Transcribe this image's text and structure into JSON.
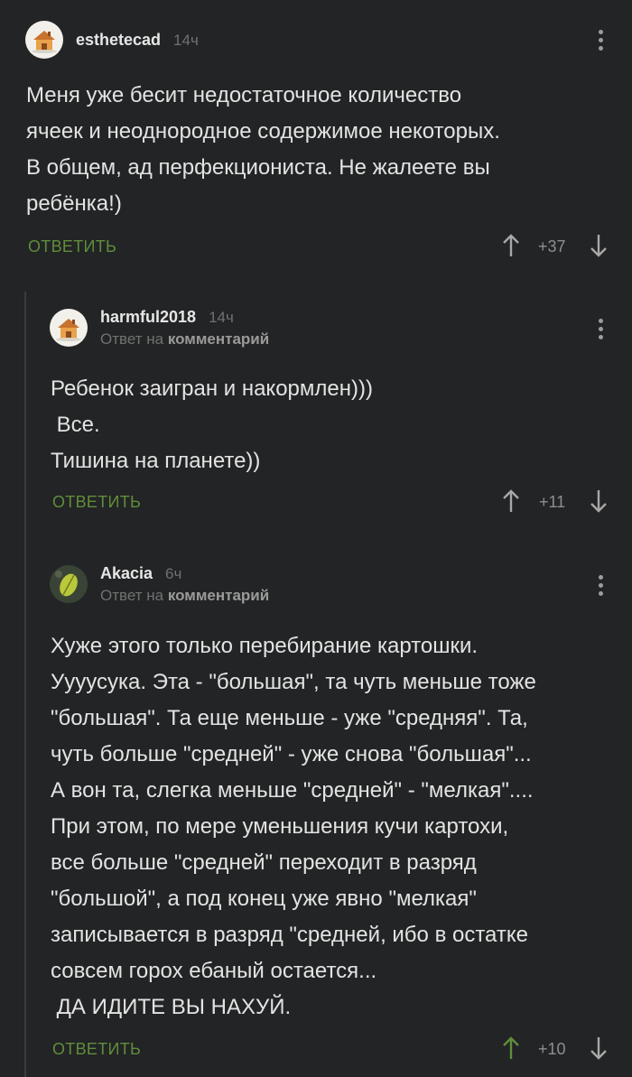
{
  "comments": [
    {
      "username": "esthetecad",
      "time": "14ч",
      "text": "Меня уже бесит недостаточное количество\nячеек и неоднородное содержимое некоторых.\nВ общем, ад перфекциониста. Не жалеете вы\nребёнка!)",
      "reply_label": "ОТВЕТИТЬ",
      "score": "+37",
      "avatar_icon": "house-avatar",
      "upvote_color": "#a8a8a8"
    },
    {
      "username": "harmful2018",
      "time": "14ч",
      "reply_to_prefix": "Ответ на",
      "reply_to_target": "комментарий",
      "text": "Ребенок заигран и накормлен)))\n Все.\nТишина на планете))",
      "reply_label": "ОТВЕТИТЬ",
      "score": "+11",
      "avatar_icon": "house-avatar",
      "upvote_color": "#a8a8a8"
    },
    {
      "username": "Akacia",
      "time": "6ч",
      "reply_to_prefix": "Ответ на",
      "reply_to_target": "комментарий",
      "text": "Хуже этого только перебирание картошки.\nУууусука. Эта - \"большая\", та чуть меньше тоже\n\"большая\". Та еще меньше - уже \"средняя\". Та,\nчуть больше \"средней\" - уже снова \"большая\"...\nА вон та, слегка меньше \"средней\" - \"мелкая\"....\nПри этом, по мере уменьшения кучи картохи,\nвсе больше \"средней\" переходит в разряд\n\"большой\", а под конец уже явно \"мелкая\"\nзаписывается в разряд \"средней, ибо в остатке\nсовсем горох ебаный остается...\n ДА ИДИТЕ ВЫ НАХУЙ.",
      "reply_label": "ОТВЕТИТЬ",
      "score": "+10",
      "avatar_icon": "leaf-avatar",
      "upvote_color": "#5f8e3c"
    }
  ],
  "colors": {
    "background": "#232425",
    "accent_green": "#5f8e3c",
    "muted": "#717171"
  }
}
